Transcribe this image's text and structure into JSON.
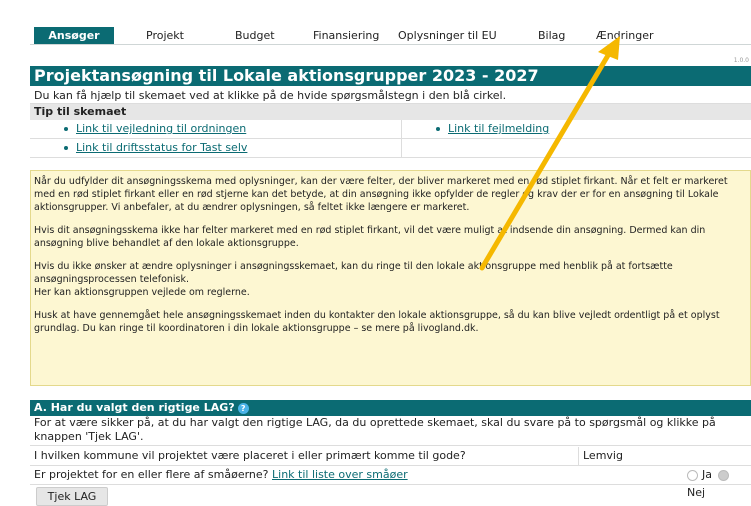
{
  "tabs": [
    {
      "label": "Ansøger",
      "active": true
    },
    {
      "label": "Projekt"
    },
    {
      "label": "Budget"
    },
    {
      "label": "Finansiering"
    },
    {
      "label": "Oplysninger til EU"
    },
    {
      "label": "Bilag"
    },
    {
      "label": "Ændringer"
    }
  ],
  "version": "1.0.0",
  "title": "Projektansøgning til Lokale aktionsgrupper 2023 - 2027",
  "help_text": "Du kan få hjælp til skemaet ved at klikke på de hvide spørgsmålstegn i den blå cirkel.",
  "tips": {
    "heading": "Tip til skemaet",
    "links": [
      "Link til vejledning til ordningen",
      "Link til fejlmelding",
      "Link til driftsstatus for Tast selv"
    ]
  },
  "info": {
    "p1": "Når du udfylder dit ansøgningsskema med oplysninger, kan der være felter, der bliver markeret med en rød stiplet firkant. Når et felt er markeret med en rød stiplet firkant eller en rød stjerne kan det betyde, at din ansøgning ikke opfylder de regler og krav der er for en ansøgning til Lokale aktionsgrupper. Vi anbefaler, at du ændrer oplysningen, så feltet ikke længere er markeret.",
    "p2": "Hvis dit ansøgningsskema ikke har felter markeret med en rød stiplet firkant, vil det være muligt at indsende din ansøgning. Dermed kan din ansøgning blive behandlet af den lokale aktionsgruppe.",
    "p3a": "Hvis du ikke ønsker at ændre oplysninger i ansøgningsskemaet, kan du ringe til den lokale aktionsgruppe med henblik på at fortsætte ansøgningsprocessen telefonisk.",
    "p3b": "Her kan aktionsgruppen vejlede om reglerne.",
    "p4": "Husk at have gennemgået hele ansøgningsskemaet inden du kontakter den lokale aktionsgruppe, så du kan blive vejledt ordentligt på et oplyst grundlag. Du kan ringe til koordinatoren i din lokale aktionsgruppe – se mere på livogland.dk."
  },
  "sectionA": {
    "heading": "A. Har du valgt den rigtige LAG?",
    "help_icon": "?",
    "description": "For at være sikker på, at du har valgt den rigtige LAG, da du oprettede skemaet, skal du svare på to spørgsmål og klikke på knappen 'Tjek LAG'.",
    "q1": "I hvilken kommune vil projektet være placeret i eller primært komme til gode?",
    "q1_answer": "Lemvig",
    "q2": "Er projektet for en eller flere af småøerne?",
    "q2_link": "Link til liste over småøer",
    "radio_yes": "Ja",
    "radio_no": "Nej",
    "button": "Tjek LAG"
  },
  "colors": {
    "accent": "#0b6b73",
    "info_bg": "#fdf7d2",
    "arrow": "#f5b800"
  }
}
